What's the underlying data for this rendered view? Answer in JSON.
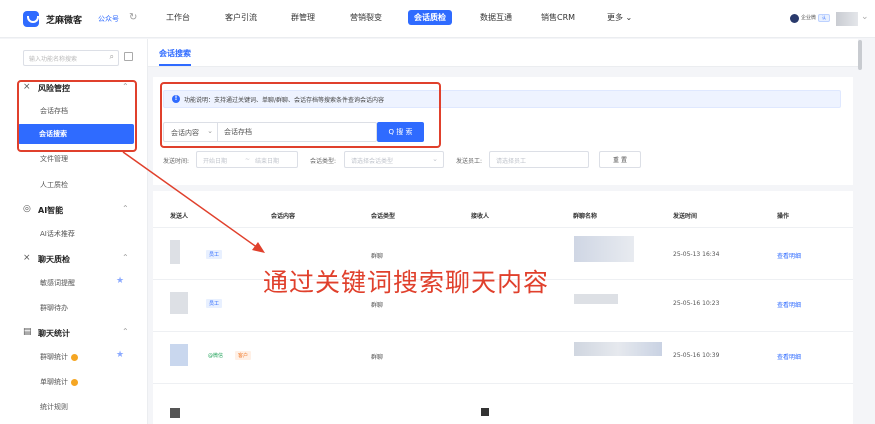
{
  "app": {
    "brand": "芝麻微客",
    "subscribe_label": "公众号",
    "topnav": [
      {
        "label": "工作台",
        "active": false
      },
      {
        "label": "客户引流",
        "active": false
      },
      {
        "label": "群管理",
        "active": false
      },
      {
        "label": "营销裂变",
        "active": false
      },
      {
        "label": "会话质检",
        "active": true
      },
      {
        "label": "数据互通",
        "active": false
      },
      {
        "label": "销售CRM",
        "active": false
      },
      {
        "label": "更多 ⌄",
        "active": false
      }
    ],
    "account": {
      "name": "企业微",
      "badge": "认"
    }
  },
  "sidebar": {
    "search_placeholder": "输入功能名称搜索",
    "groups": [
      {
        "label": "风险管控",
        "items": [
          "会话存档",
          "会话搜索",
          "文件管理",
          "人工质检"
        ]
      },
      {
        "label": "AI智能",
        "items": [
          "AI话术推荐"
        ]
      },
      {
        "label": "聊天质检",
        "items": [
          "敏感词提醒",
          "群聊待办"
        ]
      },
      {
        "label": "聊天统计",
        "items": [
          "群聊统计",
          "单聊统计",
          "统计规则"
        ]
      }
    ],
    "active_item": "会话搜索"
  },
  "main": {
    "tab": "会话搜索",
    "notice": "功能说明：支持通过关键词、单聊/群聊、会话存档等搜索条件查询会话内容",
    "search": {
      "select_value": "会话内容",
      "input_value": "会话存档",
      "button_label": "Q 搜 索"
    },
    "filters": {
      "time_label": "发送时间:",
      "start_placeholder": "开始日期",
      "sep": "~",
      "end_placeholder": "结束日期",
      "type_label": "会话类型:",
      "type_placeholder": "请选择会话类型",
      "staff_label": "发送员工:",
      "staff_placeholder": "请选择员工",
      "reset_label": "重 置"
    },
    "table": {
      "headers": [
        "发送人",
        "会话内容",
        "会话类型",
        "接收人",
        "群聊名称",
        "发送时间",
        "操作"
      ],
      "rows": [
        {
          "tag": "员工",
          "tag2": "",
          "type": "群聊",
          "time": "25-05-13 16:34",
          "action": "查看明细"
        },
        {
          "tag": "员工",
          "tag2": "",
          "type": "群聊",
          "time": "25-05-16 10:23",
          "action": "查看明细"
        },
        {
          "tag": "@微信",
          "tag2": "客户",
          "type": "群聊",
          "time": "25-05-16 10:39",
          "action": "查看明细"
        }
      ]
    }
  },
  "annotation": {
    "text": "通过关键词搜索聊天内容",
    "color": "#e0402c"
  },
  "colors": {
    "accent": "#2f6bff",
    "annotation": "#e0402c"
  }
}
